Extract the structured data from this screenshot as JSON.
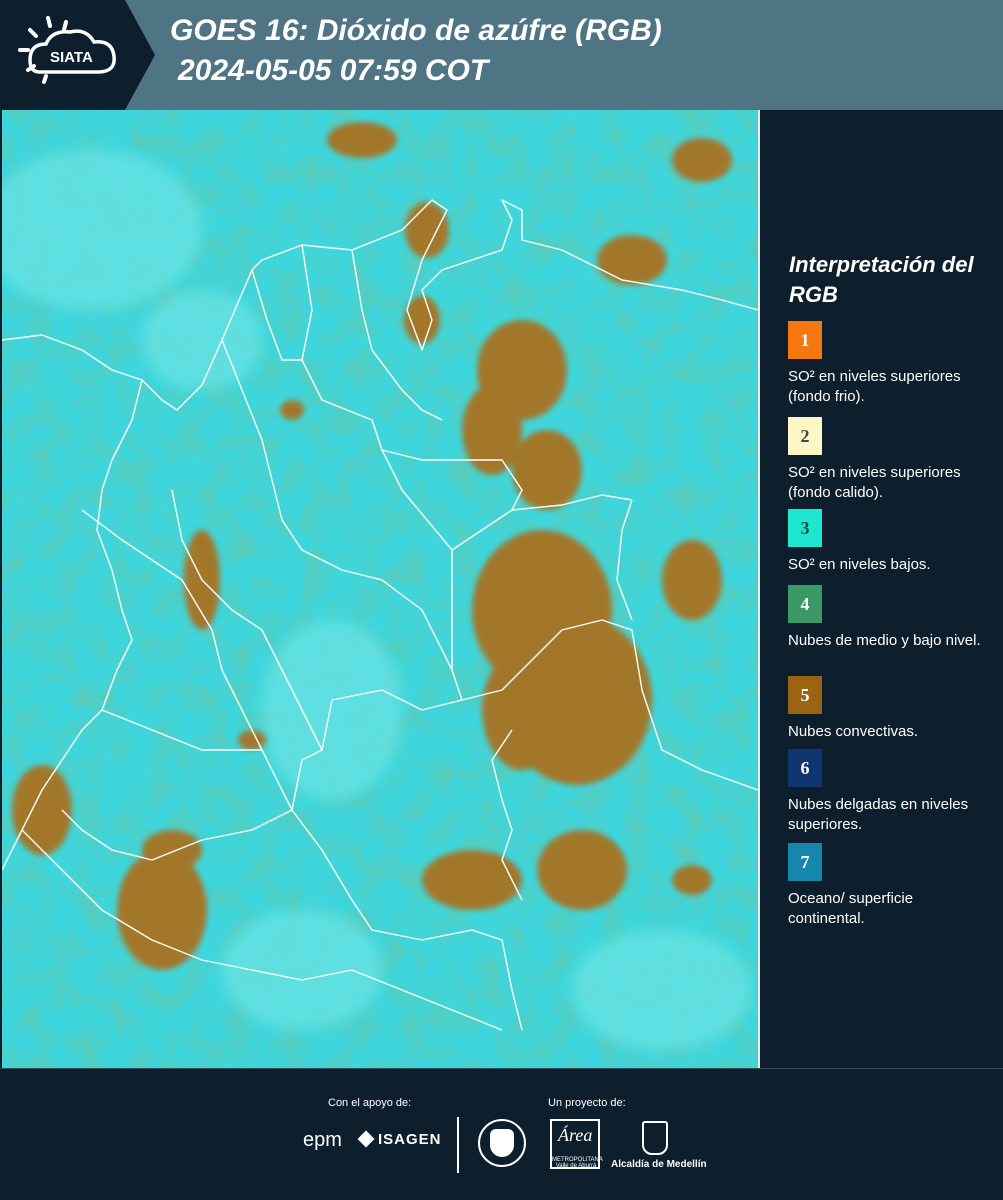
{
  "header": {
    "logo_text": "SIATA",
    "title_line1": "GOES 16: Dióxido de azúfre (RGB)",
    "title_line2": "2024-05-05 07:59 COT",
    "background": "#4f7585",
    "logo_background": "#0d1f2c"
  },
  "legend": {
    "title": "Interpretación del RGB",
    "items": [
      {
        "number": "1",
        "color": "#f5780f",
        "text_color": "#ffffff",
        "description": "SO² en niveles superiores (fondo frio)."
      },
      {
        "number": "2",
        "color": "#fdf7c6",
        "text_color": "#444444",
        "description": "SO² en niveles superiores (fondo calido)."
      },
      {
        "number": "3",
        "color": "#1de7d0",
        "text_color": "#1a4a4a",
        "description": "SO² en niveles bajos."
      },
      {
        "number": "4",
        "color": "#3a9966",
        "text_color": "#ffffff",
        "description": "Nubes de medio y bajo nivel."
      },
      {
        "number": "5",
        "color": "#9b6412",
        "text_color": "#ffffff",
        "description": "Nubes convectivas."
      },
      {
        "number": "6",
        "color": "#0f3670",
        "text_color": "#ffffff",
        "description": "Nubes delgadas en niveles superiores."
      },
      {
        "number": "7",
        "color": "#1786ac",
        "text_color": "#ffffff",
        "description": "Oceano/ superficie continental."
      }
    ]
  },
  "map": {
    "background_color": "#3fd8dc",
    "land_clear_color": "#58dfe0",
    "convective_cloud_color": "#a5782a",
    "mid_cloud_color": "#5ba35a",
    "border_color": "#ffffff"
  },
  "footer": {
    "support_label": "Con el apoyo de:",
    "project_label": "Un proyecto de:",
    "sponsors": [
      "epm",
      "ISAGEN"
    ],
    "partners": {
      "area_script": "Área",
      "area_caption": "METROPOLITANA Valle de Aburrá",
      "alcaldia": "Alcaldía de Medellín"
    }
  }
}
